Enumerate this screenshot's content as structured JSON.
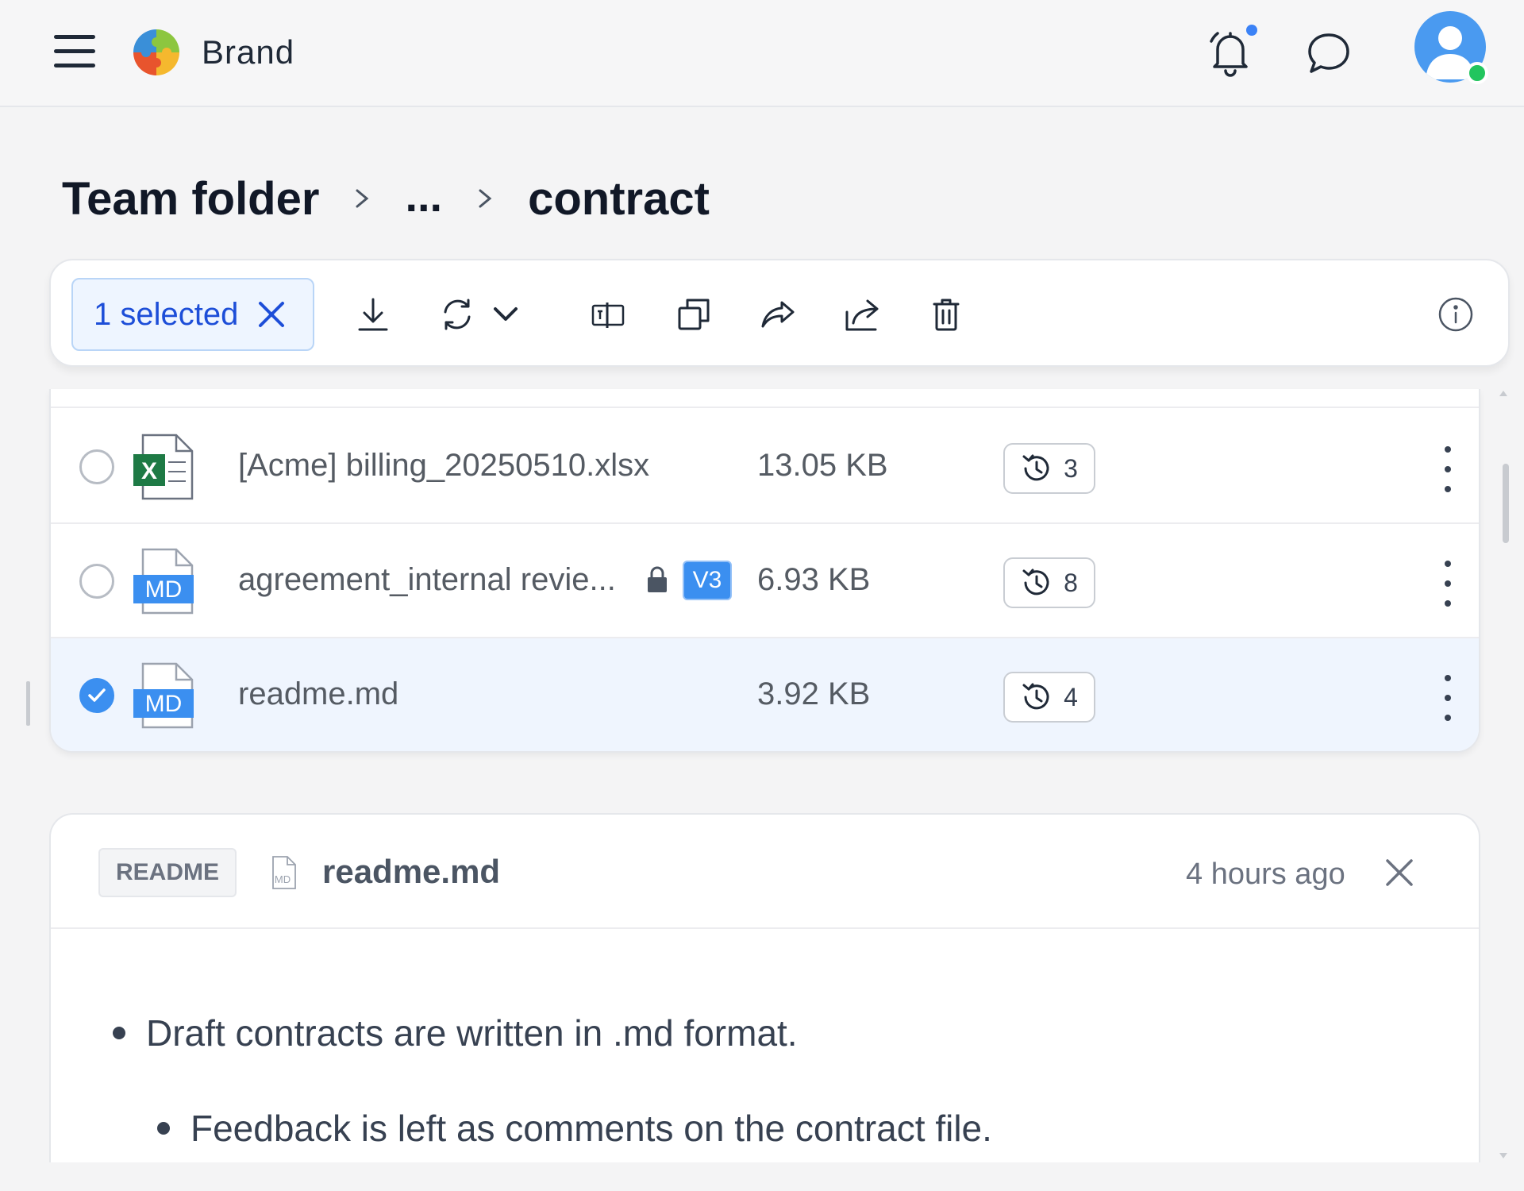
{
  "header": {
    "brand": "Brand",
    "icons": {
      "menu": "hamburger-icon",
      "logo": "puzzle-logo-icon",
      "notifications": "bell-icon",
      "messages": "chat-bubble-icon",
      "avatar": "user-avatar-icon"
    },
    "notification_dot_color": "#3b82f6",
    "online_status_color": "#22c55e"
  },
  "breadcrumb": {
    "root": "Team folder",
    "middle": "...",
    "current": "contract"
  },
  "toolbar": {
    "selection_label": "1 selected",
    "actions": [
      "download-icon",
      "sync-icon",
      "chevron-down-icon",
      "rename-icon",
      "copy-icon",
      "move-icon",
      "share-icon",
      "trash-icon",
      "info-icon"
    ],
    "accent_color": "#1d4ed8"
  },
  "files": [
    {
      "name": "[Acme] billing_20250510.xlsx",
      "type": "X",
      "size": "13.05 KB",
      "versions": "3",
      "locked": false,
      "version_badge": "",
      "selected": false
    },
    {
      "name": "agreement_internal revie...",
      "type": "MD",
      "size": "6.93 KB",
      "versions": "8",
      "locked": true,
      "version_badge": "V3",
      "selected": false
    },
    {
      "name": "readme.md",
      "type": "MD",
      "size": "3.92 KB",
      "versions": "4",
      "locked": false,
      "version_badge": "",
      "selected": true
    }
  ],
  "readme": {
    "tag": "README",
    "file_icon_text": "MD",
    "file_name": "readme.md",
    "time": "4 hours ago",
    "bullets": [
      "Draft contracts are written in .md format.",
      "Feedback is left as comments on the contract file."
    ]
  },
  "colors": {
    "selected_row_bg": "#eff5fe",
    "checkbox_blue": "#3b8ff0",
    "excel_green": "#1e7a45",
    "md_blue": "#3b8ff0"
  }
}
